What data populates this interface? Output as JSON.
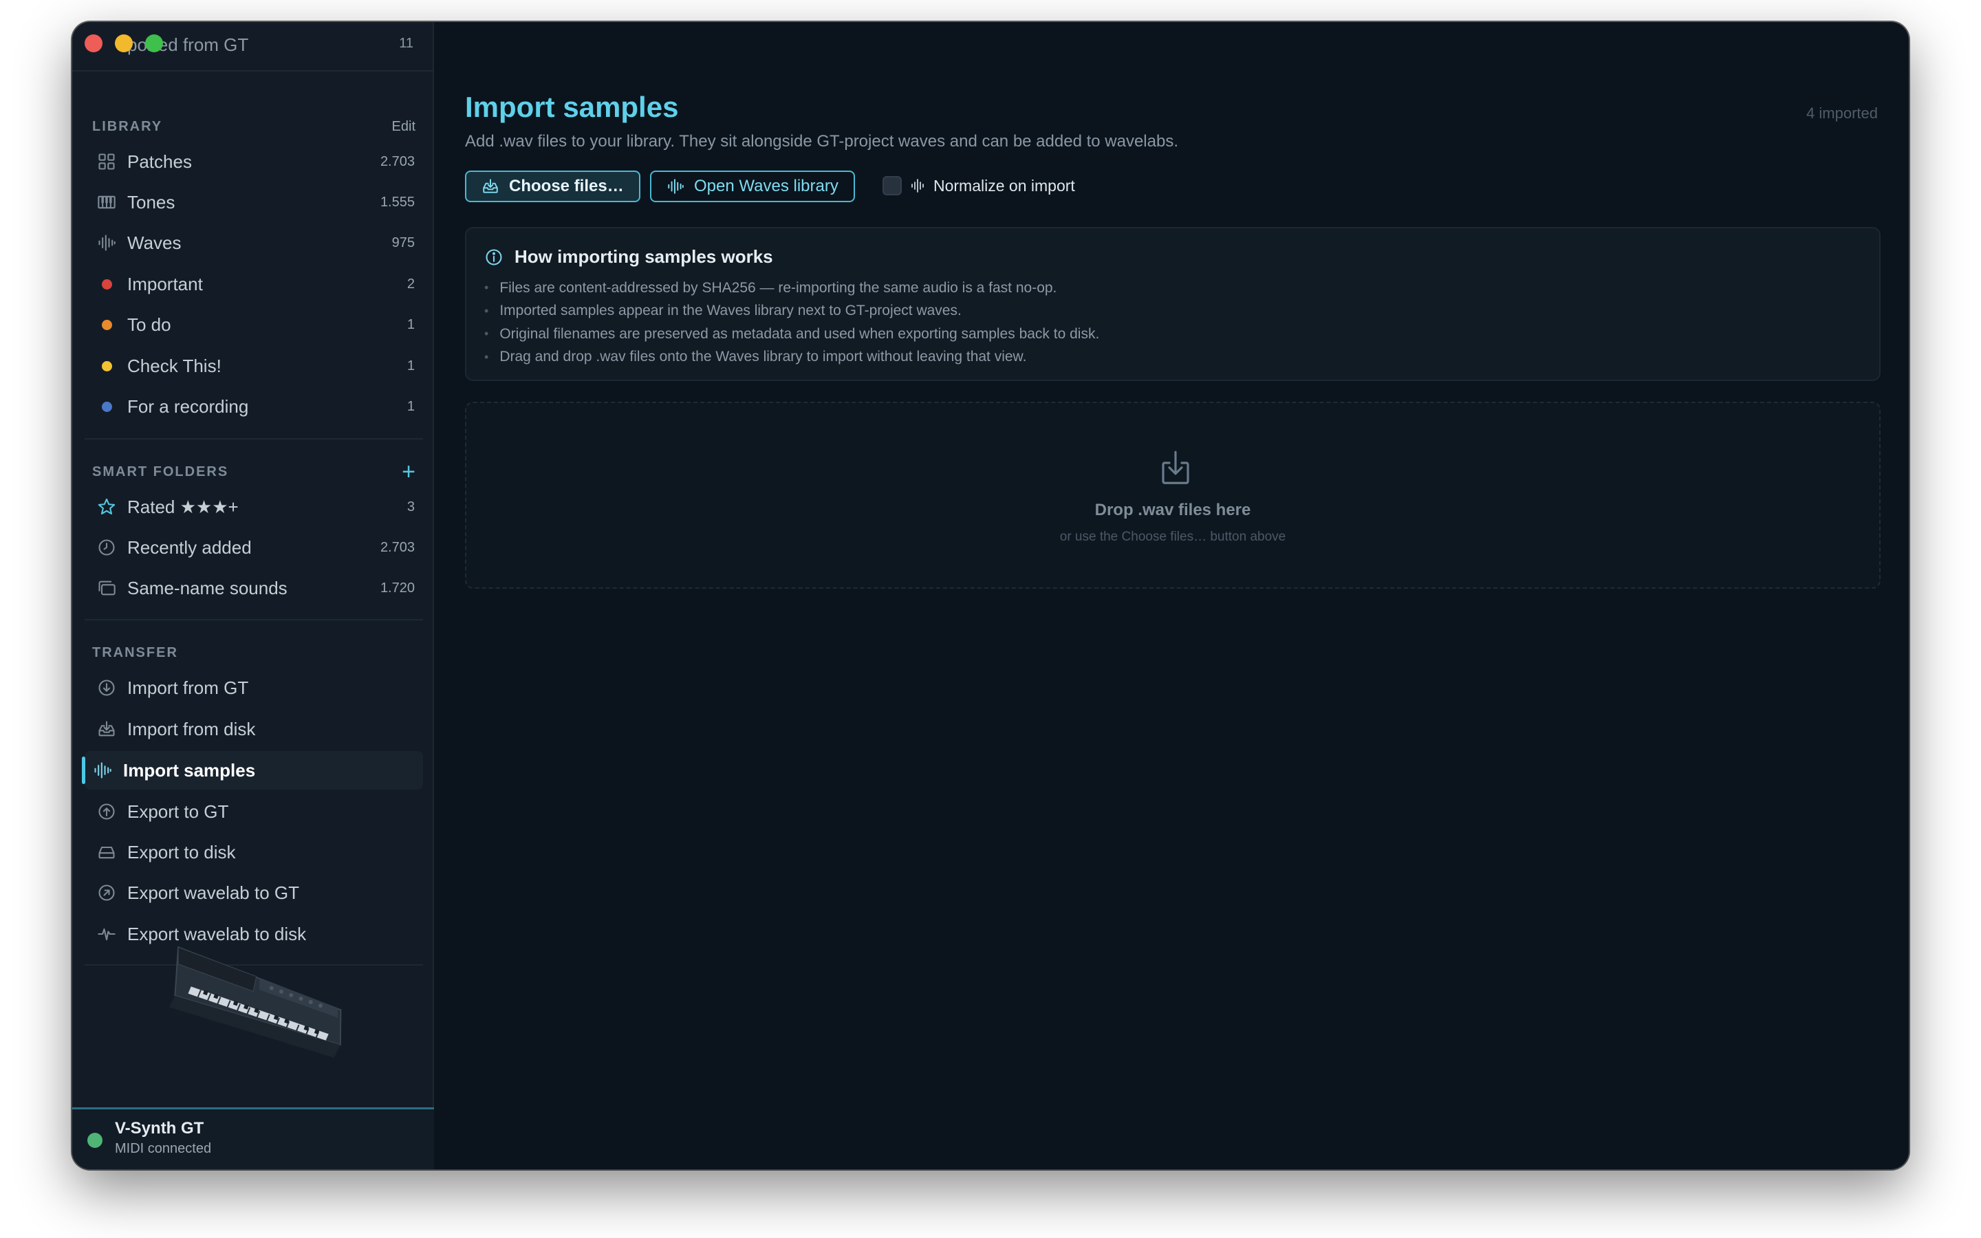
{
  "window": {
    "title_partial": "ported from GT",
    "title_count": "11"
  },
  "sidebar": {
    "library": {
      "heading": "LIBRARY",
      "action": "Edit",
      "items": [
        {
          "label": "Patches",
          "count": "2.703",
          "icon": "grid-icon"
        },
        {
          "label": "Tones",
          "count": "1.555",
          "icon": "piano-keys-icon"
        },
        {
          "label": "Waves",
          "count": "975",
          "icon": "waveform-icon"
        },
        {
          "label": "Important",
          "count": "2",
          "color": "#d9443c"
        },
        {
          "label": "To do",
          "count": "1",
          "color": "#e88a2e"
        },
        {
          "label": "Check This!",
          "count": "1",
          "color": "#f3c233"
        },
        {
          "label": "For a recording",
          "count": "1",
          "color": "#4a78c9"
        }
      ]
    },
    "smart_folders": {
      "heading": "SMART FOLDERS",
      "action": "+",
      "items": [
        {
          "label": "Rated ★★★+",
          "count": "3",
          "icon": "star-icon"
        },
        {
          "label": "Recently added",
          "count": "2.703",
          "icon": "clock-icon"
        },
        {
          "label": "Same-name sounds",
          "count": "1.720",
          "icon": "stacked-folders-icon"
        }
      ]
    },
    "transfer": {
      "heading": "TRANSFER",
      "items": [
        {
          "label": "Import from GT",
          "icon": "arrow-down-circle-icon"
        },
        {
          "label": "Import from disk",
          "icon": "tray-download-icon"
        },
        {
          "label": "Import samples",
          "icon": "waveform-icon",
          "active": true
        },
        {
          "label": "Export to GT",
          "icon": "arrow-up-circle-icon"
        },
        {
          "label": "Export to disk",
          "icon": "drive-icon"
        },
        {
          "label": "Export wavelab to GT",
          "icon": "arrow-up-right-circle-icon"
        },
        {
          "label": "Export wavelab to disk",
          "icon": "pulse-icon"
        }
      ]
    },
    "device": {
      "name": "V-Synth GT",
      "status": "MIDI connected",
      "status_color": "#4fb476"
    }
  },
  "main": {
    "title": "Import samples",
    "subtitle": "Add .wav files to your library. They sit alongside GT-project waves and can be added to wavelabs.",
    "imported_count": "4 imported",
    "buttons": {
      "choose": "Choose files…",
      "open_library": "Open Waves library",
      "normalize": "Normalize on import"
    },
    "info": {
      "title": "How importing samples works",
      "items": [
        "Files are content-addressed by SHA256 — re-importing the same audio is a fast no-op.",
        "Imported samples appear in the Waves library next to GT-project waves.",
        "Original filenames are preserved as metadata and used when exporting samples back to disk.",
        "Drag and drop .wav files onto the Waves library to import without leaving that view."
      ]
    },
    "dropzone": {
      "title": "Drop .wav files here",
      "subtitle": "or use the Choose files… button above"
    }
  },
  "colors": {
    "accent": "#5fd0ea",
    "background": "#0b141d",
    "sidebar": "#131c26"
  }
}
